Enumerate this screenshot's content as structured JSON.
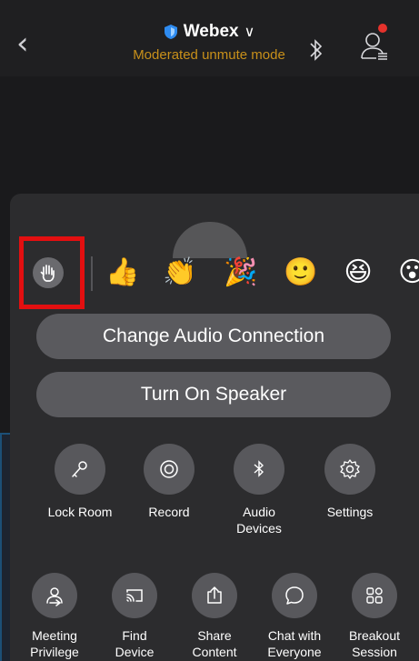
{
  "header": {
    "title": "Webex",
    "subtitle": "Moderated unmute mode",
    "notification_color": "#e5322c",
    "subtitle_color": "#c8901a"
  },
  "reactions": {
    "items": [
      {
        "name": "raise-hand",
        "glyph": ""
      },
      {
        "name": "thumbs-up",
        "glyph": "👍"
      },
      {
        "name": "clap",
        "glyph": "👏"
      },
      {
        "name": "party-popper",
        "glyph": "🎉"
      },
      {
        "name": "smile",
        "glyph": "🙂"
      },
      {
        "name": "laugh",
        "glyph": "😆"
      },
      {
        "name": "surprised",
        "glyph": "😮"
      }
    ]
  },
  "actions": {
    "change_audio": "Change Audio Connection",
    "turn_on_speaker": "Turn On Speaker"
  },
  "grid_row1": [
    {
      "label": "Lock Room",
      "icon": "key-icon"
    },
    {
      "label": "Record",
      "icon": "record-icon"
    },
    {
      "label": "Audio\nDevices",
      "icon": "bluetooth-icon"
    },
    {
      "label": "Settings",
      "icon": "gear-icon"
    }
  ],
  "grid_row2": [
    {
      "label": "Meeting\nPrivilege",
      "icon": "person-arrow-icon"
    },
    {
      "label": "Find\nDevice",
      "icon": "cast-icon"
    },
    {
      "label": "Share\nContent",
      "icon": "share-icon"
    },
    {
      "label": "Chat with\nEveryone",
      "icon": "chat-icon"
    },
    {
      "label": "Breakout\nSession",
      "icon": "grid-icon"
    }
  ]
}
